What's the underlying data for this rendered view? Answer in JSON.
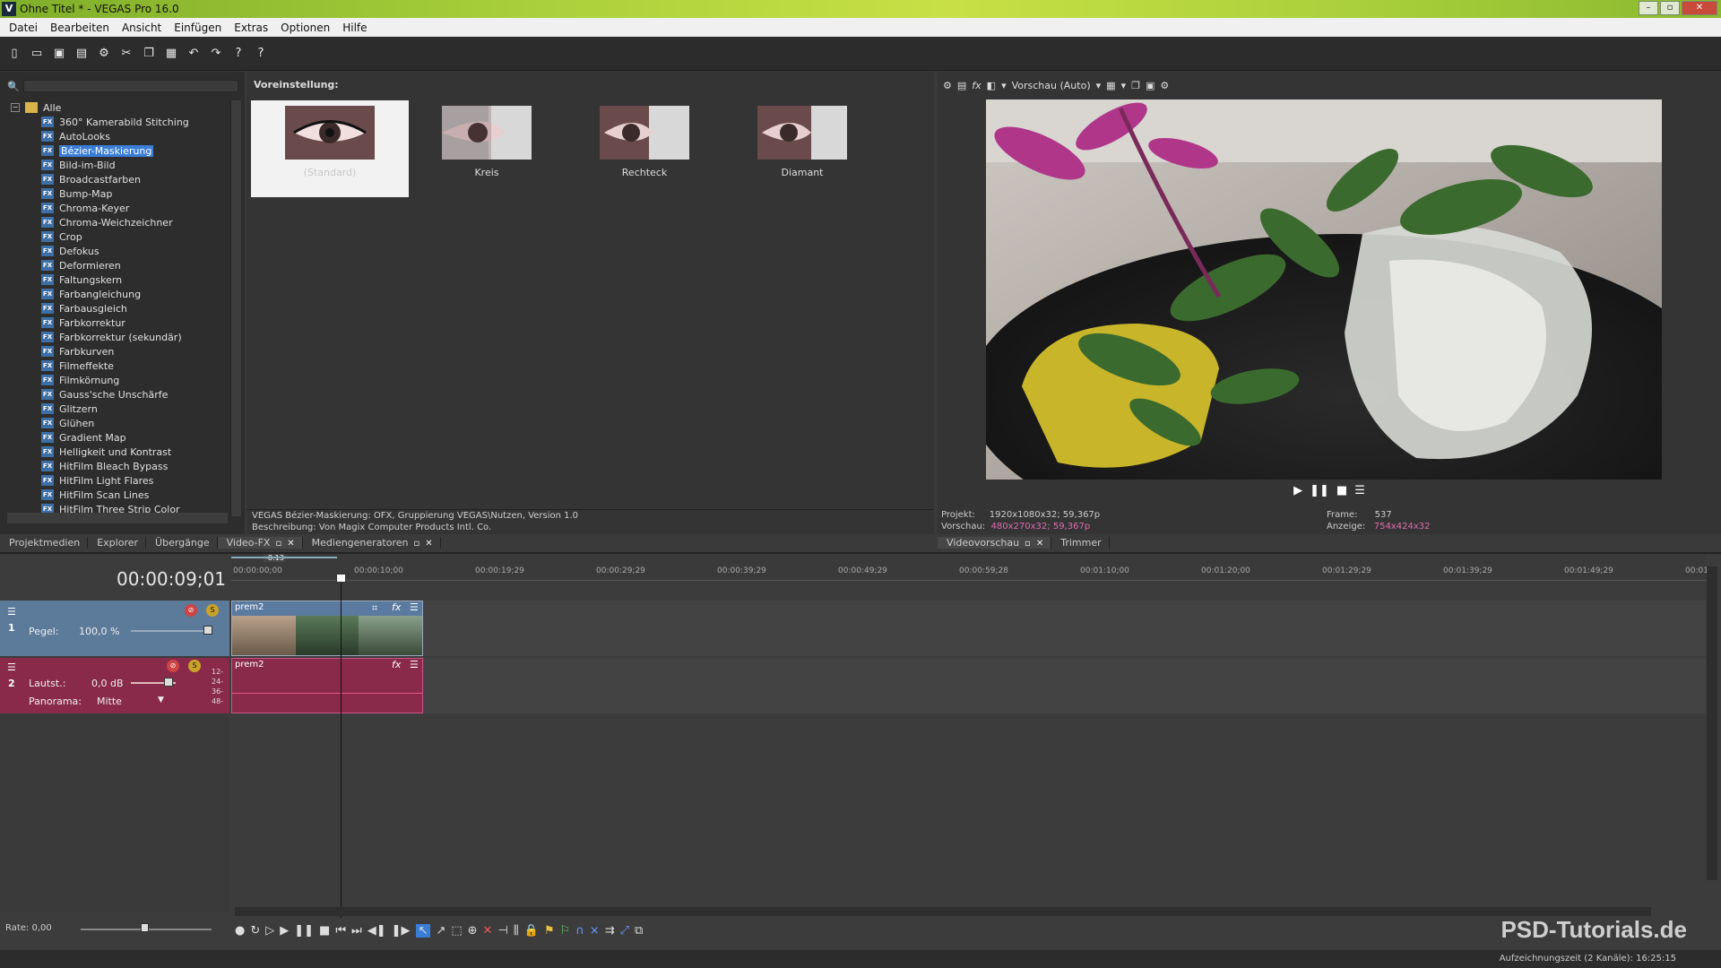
{
  "window": {
    "title": "Ohne Titel * - VEGAS Pro 16.0",
    "logo": "V"
  },
  "menu": [
    "Datei",
    "Bearbeiten",
    "Ansicht",
    "Einfügen",
    "Extras",
    "Optionen",
    "Hilfe"
  ],
  "fx_panel": {
    "search_placeholder": "",
    "root": "Alle",
    "items": [
      "360° Kamerabild Stitching",
      "AutoLooks",
      "Bézier-Maskierung",
      "Bild-im-Bild",
      "Broadcastfarben",
      "Bump-Map",
      "Chroma-Keyer",
      "Chroma-Weichzeichner",
      "Crop",
      "Defokus",
      "Deformieren",
      "Faltungskern",
      "Farbangleichung",
      "Farbausgleich",
      "Farbkorrektur",
      "Farbkorrektur (sekundär)",
      "Farbkurven",
      "Filmeffekte",
      "Filmkörnung",
      "Gauss'sche Unschärfe",
      "Glitzern",
      "Glühen",
      "Gradient Map",
      "Helligkeit und Kontrast",
      "HitFilm Bleach Bypass",
      "HitFilm Light Flares",
      "HitFilm Scan Lines",
      "HitFilm Three Strip Color"
    ],
    "selected_index": 2
  },
  "presets": {
    "header": "Voreinstellung:",
    "items": [
      "(Standard)",
      "Kreis",
      "Rechteck",
      "Diamant"
    ],
    "info_line1": "VEGAS Bézier-Maskierung: OFX, Gruppierung VEGAS\\Nutzen, Version 1.0",
    "info_line2": "Beschreibung: Von Magix Computer Products Intl. Co."
  },
  "tabs_left": [
    "Projektmedien",
    "Explorer",
    "Übergänge",
    "Video-FX",
    "Mediengeneratoren"
  ],
  "preview": {
    "mode": "Vorschau (Auto)",
    "projekt_label": "Projekt:",
    "projekt_value": "1920x1080x32; 59,367p",
    "vorschau_label": "Vorschau:",
    "vorschau_value": "480x270x32; 59,367p",
    "frame_label": "Frame:",
    "frame_value": "537",
    "anzeige_label": "Anzeige:",
    "anzeige_value": "754x424x32",
    "tabs": [
      "Videovorschau",
      "Trimmer"
    ]
  },
  "timeline": {
    "timecode": "00:00:09;01",
    "marker": "-8:13",
    "ruler": [
      "00:00:00;00",
      "00:00:10;00",
      "00:00:19;29",
      "00:00:29;29",
      "00:00:39;29",
      "00:00:49;29",
      "00:00:59;28",
      "00:01:10;00",
      "00:01:20;00",
      "00:01:29;29",
      "00:01:39;29",
      "00:01:49;29",
      "00:01:"
    ],
    "track1": {
      "num": "1",
      "level_label": "Pegel:",
      "level_value": "100,0 %",
      "clip": "prem2"
    },
    "track2": {
      "num": "2",
      "vol_label": "Lautst.:",
      "vol_value": "0,0 dB",
      "pan_label": "Panorama:",
      "pan_value": "Mitte",
      "clip": "prem2",
      "meters": [
        "12-",
        "24-",
        "36-",
        "48-"
      ]
    },
    "rate": "Rate: 0,00"
  },
  "status": {
    "text": "Aufzeichnungszeit (2 Kanäle): 16:25:15"
  },
  "watermark": "PSD-Tutorials.de",
  "colors": {
    "accent": "#3a7dd6",
    "titlebar": "#a8cf3a",
    "audio_track": "#8a2a4a",
    "video_track": "#5c7a9a"
  }
}
